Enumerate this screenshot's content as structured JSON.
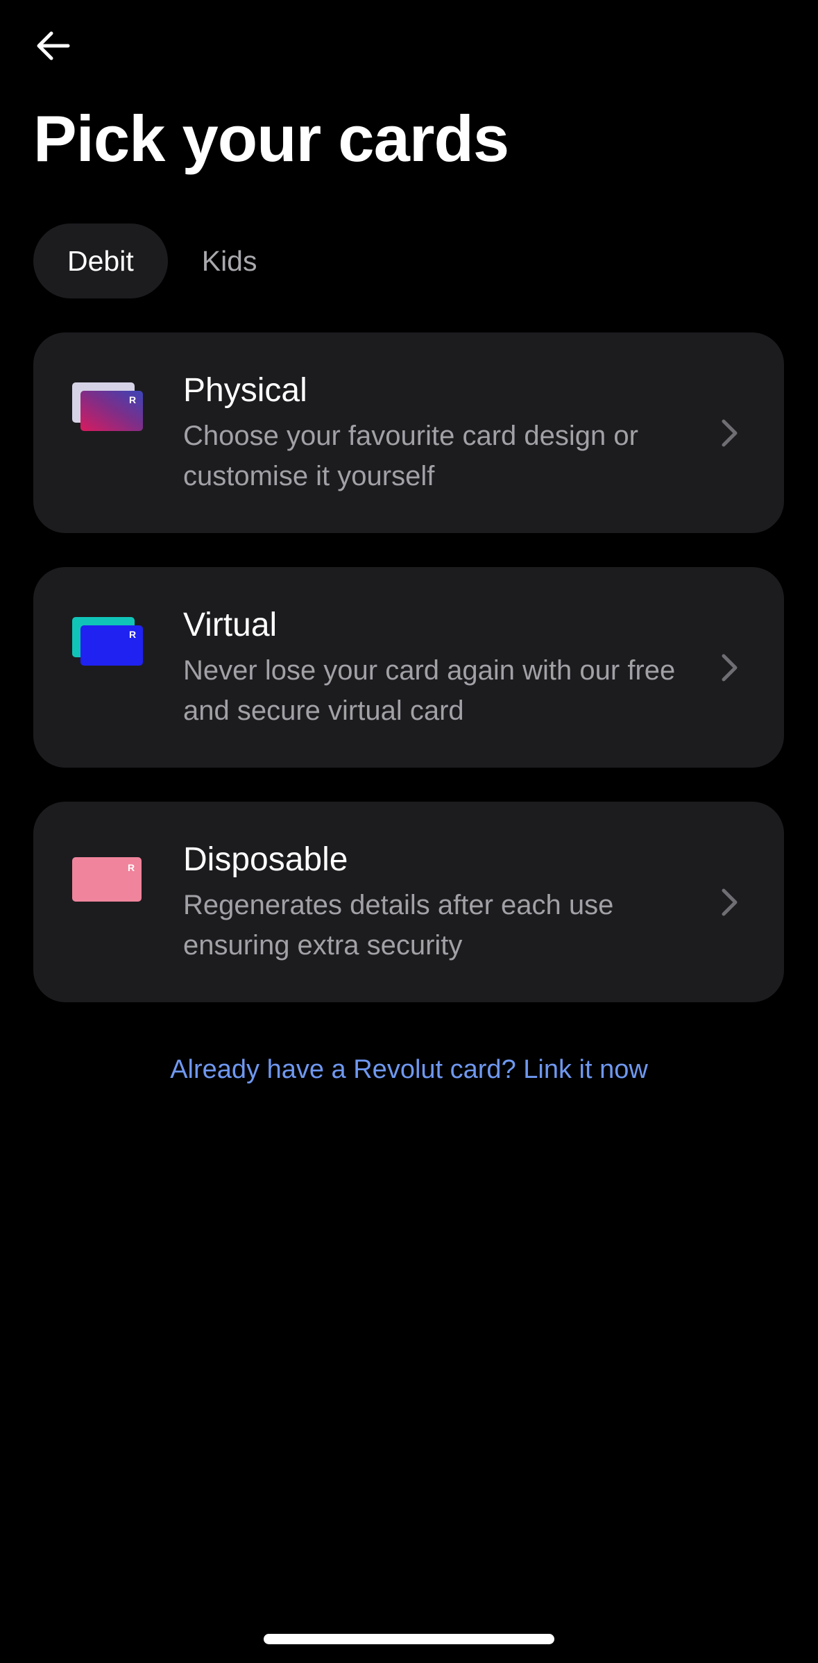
{
  "header": {
    "back_icon": "arrow-left-icon",
    "title": "Pick your cards"
  },
  "tabs": [
    {
      "label": "Debit",
      "active": true
    },
    {
      "label": "Kids",
      "active": false
    }
  ],
  "options": [
    {
      "name": "Physical",
      "description": "Choose your favourite card design or customise it yourself",
      "icon": "physical-card-icon",
      "card_mark": "R"
    },
    {
      "name": "Virtual",
      "description": "Never lose your card again with our free and secure virtual card",
      "icon": "virtual-card-icon",
      "card_mark": "R"
    },
    {
      "name": "Disposable",
      "description": "Regenerates details after each use ensuring extra security",
      "icon": "disposable-card-icon",
      "card_mark": "R"
    }
  ],
  "link": {
    "label": "Already have a Revolut card? Link it now"
  },
  "colors": {
    "background": "#000000",
    "surface": "#1c1c1f",
    "link": "#6f98f0",
    "secondary_text": "#a1a1a6"
  }
}
